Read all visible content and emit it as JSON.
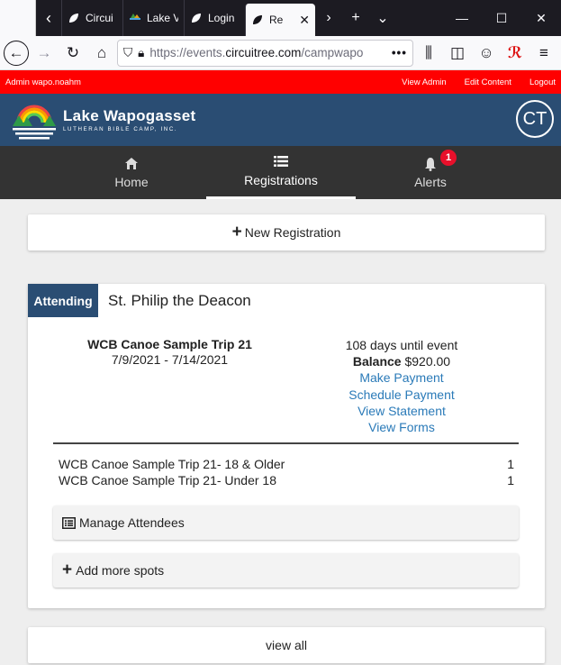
{
  "browser": {
    "tabs": [
      {
        "title": "Circui",
        "active": false
      },
      {
        "title": "Lake V",
        "active": false
      },
      {
        "title": "Login",
        "active": false
      },
      {
        "title": "Re",
        "active": true
      }
    ],
    "url_host": "https://events.",
    "url_domain": "circuitree.com",
    "url_path": "/campwapo",
    "url_more": "•••"
  },
  "admin_bar": {
    "user": "Admin wapo.noahm",
    "links": [
      "View Admin",
      "Edit Content",
      "Logout"
    ]
  },
  "header": {
    "brand_name": "Lake Wapogasset",
    "brand_sub": "LUTHERAN BIBLE CAMP, INC.",
    "avatar_initials": "CT"
  },
  "nav": {
    "items": [
      {
        "label": "Home",
        "icon": "home-icon"
      },
      {
        "label": "Registrations",
        "icon": "list-icon"
      },
      {
        "label": "Alerts",
        "icon": "bell-icon",
        "badge": "1"
      }
    ],
    "active": "Registrations"
  },
  "new_registration": {
    "label": "New Registration"
  },
  "registration": {
    "status": "Attending",
    "church": "St. Philip the Deacon",
    "event_name": "WCB Canoe Sample Trip 21",
    "event_dates": "7/9/2021 - 7/14/2021",
    "days_until": "108 days until event",
    "balance_label": "Balance",
    "balance_value": "$920.00",
    "actions": [
      "Make Payment",
      "Schedule Payment",
      "View Statement",
      "View Forms"
    ],
    "lines": [
      {
        "name": "WCB Canoe Sample Trip 21- 18 & Older",
        "qty": "1"
      },
      {
        "name": "WCB Canoe Sample Trip 21- Under 18",
        "qty": "1"
      }
    ],
    "manage_label": "Manage Attendees",
    "add_spots_label": "Add more spots"
  },
  "view_all": {
    "label": "view all"
  },
  "colors": {
    "admin_bar": "#ff0000",
    "header": "#2a4d73",
    "nav": "#333333",
    "link": "#2a7ab8",
    "badge": "#e8102b"
  }
}
